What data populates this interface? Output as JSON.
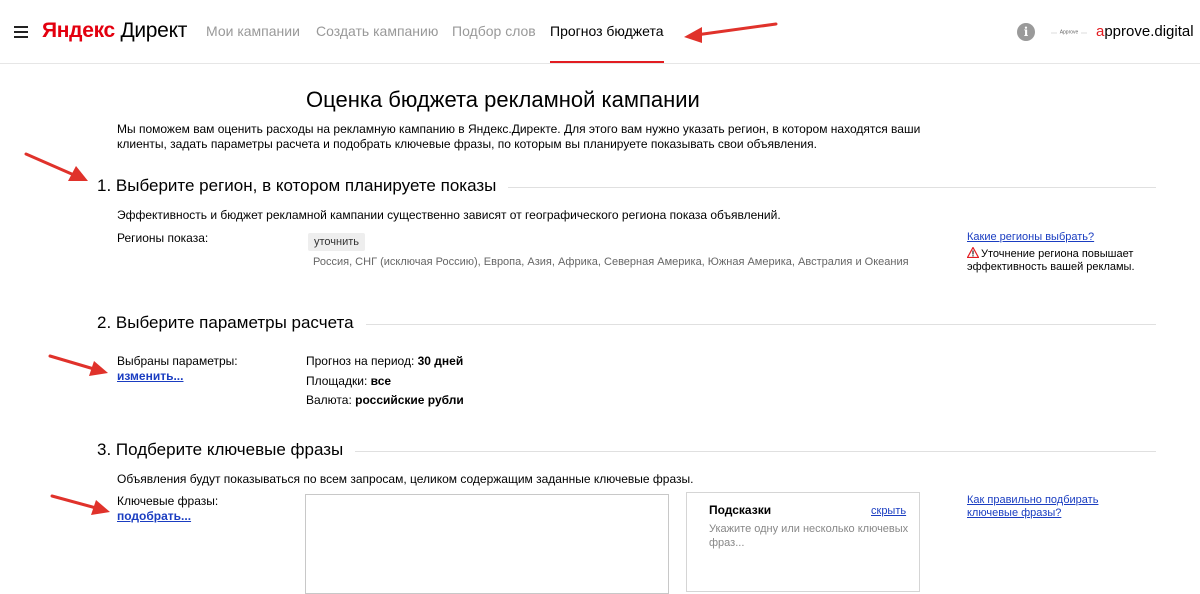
{
  "header": {
    "logo_ya": "Яндекс",
    "logo_direct": "Директ",
    "nav": [
      {
        "label": "Мои кампании"
      },
      {
        "label": "Создать кампанию"
      },
      {
        "label": "Подбор слов"
      },
      {
        "label": "Прогноз бюджета"
      }
    ],
    "info_icon_glyph": "i",
    "approve_logo_text": "Approve",
    "user_first": "a",
    "user_rest": "pprove.digital"
  },
  "page": {
    "title": "Оценка бюджета рекламной кампании",
    "intro": "Мы поможем вам оценить расходы на рекламную кампанию в Яндекс.Директе. Для этого вам нужно указать регион, в котором находятся ваши клиенты, задать параметры расчета и подобрать ключевые фразы, по которым вы планируете показывать свои объявления."
  },
  "section1": {
    "title": "1. Выберите регион, в котором планируете показы",
    "description": "Эффективность и бюджет рекламной кампании существенно зависят от географического региона показа объявлений.",
    "regions_label": "Регионы показа:",
    "clarify_button": "уточнить",
    "regions_value": "Россия, СНГ (исключая Россию), Европа, Азия, Африка, Северная Америка, Южная Америка, Австралия и Океания",
    "help_link": "Какие регионы выбрать?",
    "warning": "Уточнение региона повышает эффективность вашей рекламы."
  },
  "section2": {
    "title": "2. Выберите параметры расчета",
    "params_label": "Выбраны параметры:",
    "change_link": "изменить...",
    "period_label": "Прогноз на период:",
    "period_value": "30 дней",
    "platforms_label": "Площадки:",
    "platforms_value": "все",
    "currency_label": "Валюта:",
    "currency_value": "российские рубли"
  },
  "section3": {
    "title": "3. Подберите ключевые фразы",
    "description": "Объявления будут показываться по всем запросам, целиком содержащим заданные ключевые фразы.",
    "phrases_label": "Ключевые фразы:",
    "pick_link": "подобрать...",
    "hints_title": "Подсказки",
    "hints_hide": "скрыть",
    "hints_text": "Укажите одну или несколько ключевых фраз...",
    "help_link": "Как правильно подбирать ключевые фразы?"
  },
  "colors": {
    "brand_red": "#e3000f",
    "link_blue": "#1a3dc1",
    "arrow_red": "#e0322b"
  }
}
